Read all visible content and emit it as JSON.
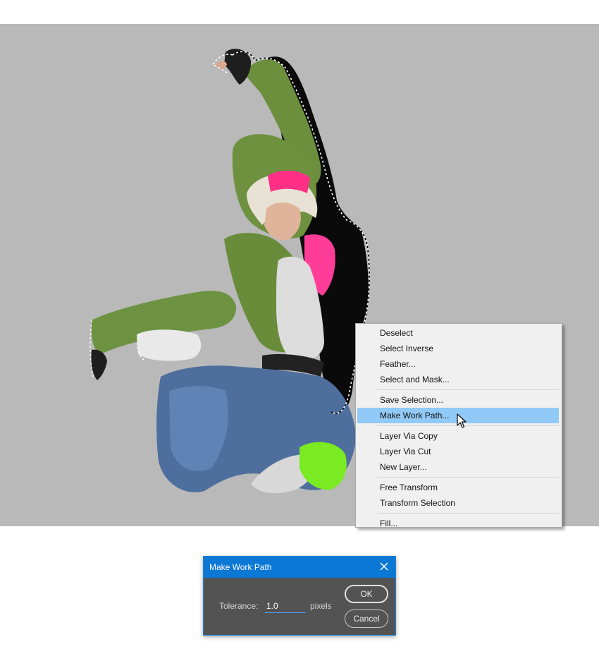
{
  "context_menu": {
    "items": [
      {
        "label": "Deselect"
      },
      {
        "label": "Select Inverse"
      },
      {
        "label": "Feather..."
      },
      {
        "label": "Select and Mask..."
      },
      {
        "label": "Save Selection..."
      },
      {
        "label": "Make Work Path...",
        "highlighted": true
      },
      {
        "label": "Layer Via Copy"
      },
      {
        "label": "Layer Via Cut"
      },
      {
        "label": "New Layer..."
      },
      {
        "label": "Free Transform"
      },
      {
        "label": "Transform Selection"
      },
      {
        "label": "Fill..."
      }
    ]
  },
  "dialog": {
    "title": "Make Work Path",
    "tolerance_label": "Tolerance:",
    "tolerance_value": "1.0",
    "tolerance_unit": "pixels",
    "ok_label": "OK",
    "cancel_label": "Cancel"
  },
  "colors": {
    "canvas_bg": "#b9b9b9",
    "menu_highlight": "#91c9f7",
    "dialog_titlebar": "#0c78d6",
    "dialog_body": "#535353"
  },
  "icons": {
    "close": "close-icon",
    "cursor": "arrow-cursor-icon"
  }
}
